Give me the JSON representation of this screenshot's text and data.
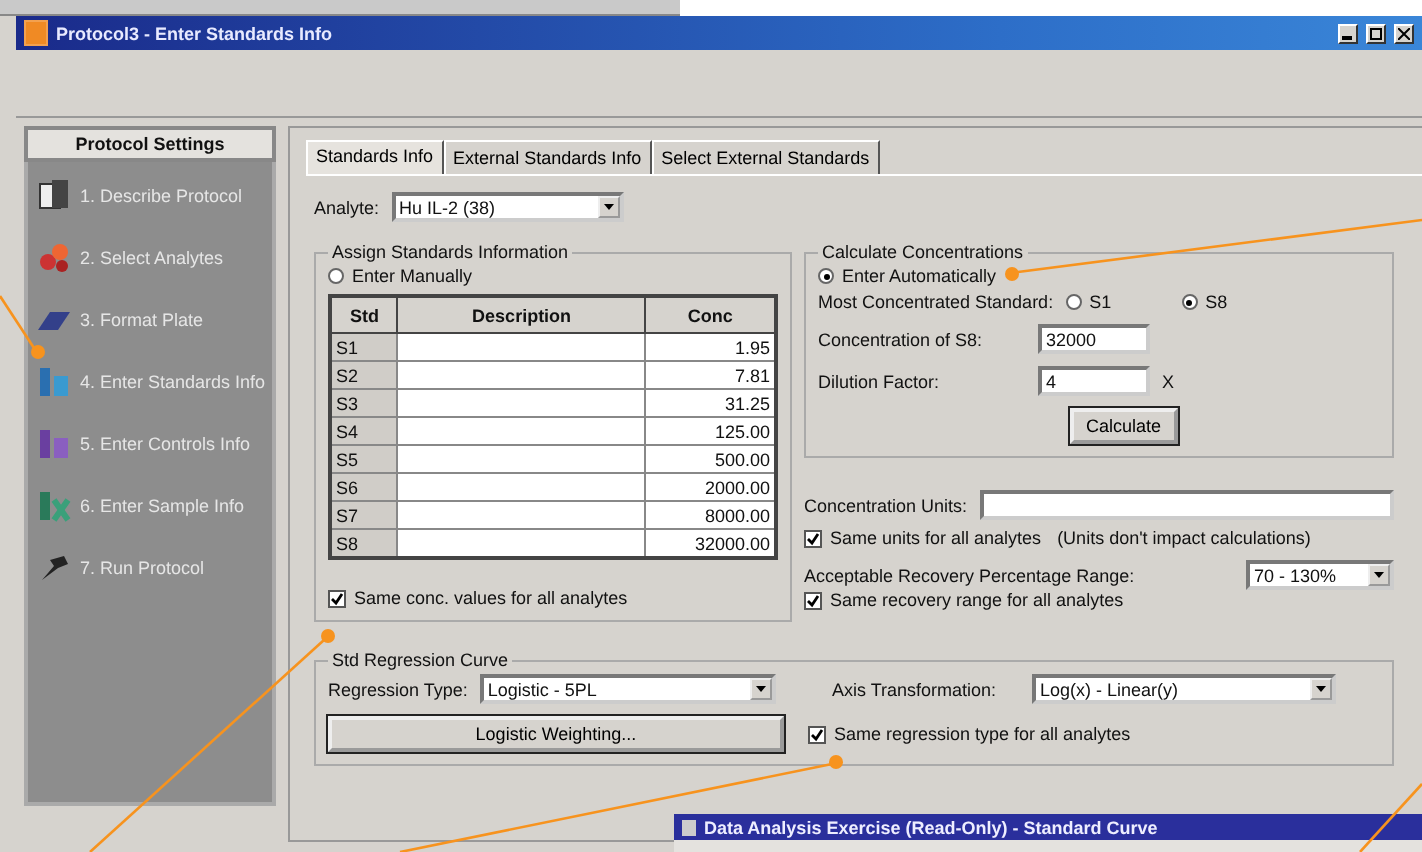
{
  "window": {
    "title": "Protocol3 - Enter Standards Info"
  },
  "sidebar": {
    "title": "Protocol Settings",
    "items": [
      {
        "label": "1. Describe Protocol",
        "kind": "describe"
      },
      {
        "label": "2. Select Analytes",
        "kind": "analytes"
      },
      {
        "label": "3. Format Plate",
        "kind": "plate"
      },
      {
        "label": "4. Enter Standards Info",
        "kind": "standards"
      },
      {
        "label": "5. Enter Controls Info",
        "kind": "controls"
      },
      {
        "label": "6. Enter Sample Info",
        "kind": "samples"
      },
      {
        "label": "7. Run Protocol",
        "kind": "run"
      }
    ]
  },
  "tabs": [
    {
      "label": "Standards Info",
      "selected": true
    },
    {
      "label": "External Standards Info",
      "selected": false
    },
    {
      "label": "Select External Standards",
      "selected": false
    }
  ],
  "analyte": {
    "label": "Analyte:",
    "value": "Hu IL-2 (38)"
  },
  "assign": {
    "title": "Assign Standards Information",
    "manual_option": {
      "label": "Enter Manually",
      "selected": false
    },
    "columns": [
      "Std",
      "Description",
      "Conc"
    ],
    "rows": [
      {
        "std": "S1",
        "conc": "1.95"
      },
      {
        "std": "S2",
        "conc": "7.81"
      },
      {
        "std": "S3",
        "conc": "31.25"
      },
      {
        "std": "S4",
        "conc": "125.00"
      },
      {
        "std": "S5",
        "conc": "500.00"
      },
      {
        "std": "S6",
        "conc": "2000.00"
      },
      {
        "std": "S7",
        "conc": "8000.00"
      },
      {
        "std": "S8",
        "conc": "32000.00"
      }
    ],
    "same": {
      "label": "Same conc. values for all analytes",
      "checked": true
    }
  },
  "calculate": {
    "title": "Calculate Concentrations",
    "auto_option": {
      "label": "Enter Automatically",
      "selected": true
    },
    "most_label": "Most Concentrated Standard:",
    "standard_options": [
      {
        "label": "S1",
        "selected": false
      },
      {
        "label": "S8",
        "selected": true
      }
    ],
    "conc_label": "Concentration of S8:",
    "conc_value": "32000",
    "dilution_label": "Dilution Factor:",
    "dilution_value": "4",
    "dilution_suffix": "X",
    "button": "Calculate"
  },
  "units": {
    "label": "Concentration Units:",
    "same": {
      "label": "Same units for all analytes",
      "checked": true
    },
    "note": "(Units don't impact calculations)"
  },
  "recovery": {
    "label": "Acceptable Recovery Percentage Range:",
    "value": "70 - 130%",
    "same": {
      "label": "Same recovery range for all analytes",
      "checked": true
    }
  },
  "regression": {
    "title": "Std Regression Curve",
    "type_label": "Regression Type:",
    "type_value": "Logistic - 5PL",
    "axis_label": "Axis Transformation:",
    "axis_value": "Log(x) - Linear(y)",
    "weighting_button": "Logistic Weighting...",
    "same": {
      "label": "Same regression type for all analytes",
      "checked": true
    }
  },
  "second_window": {
    "title": "Data Analysis Exercise (Read-Only) - Standard Curve"
  }
}
